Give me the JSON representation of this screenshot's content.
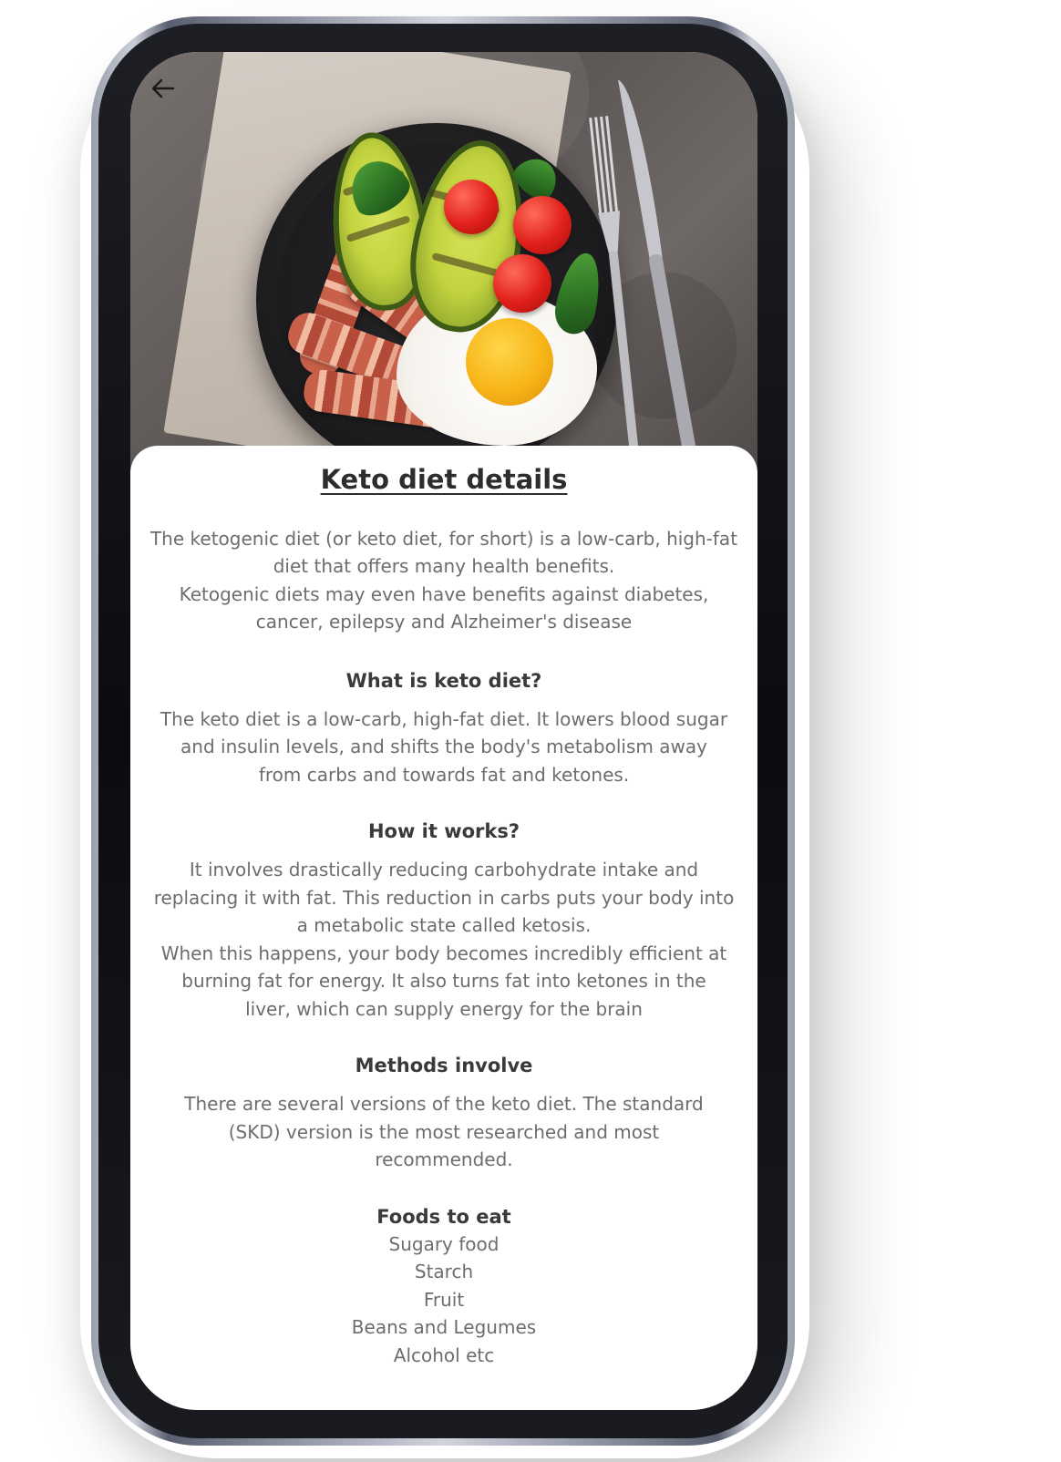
{
  "header": {
    "back_icon": "arrow-left-icon",
    "hero_image": "keto-breakfast-photo"
  },
  "article": {
    "title": "Keto diet details",
    "intro_line1": "The ketogenic diet (or keto diet, for short) is a low-carb, high-fat diet that offers many health benefits.",
    "intro_line2": "Ketogenic diets may even have benefits against diabetes, cancer, epilepsy and Alzheimer's disease",
    "sections": [
      {
        "heading": "What is keto diet?",
        "body": "The keto diet is a low-carb, high-fat diet. It lowers blood sugar and insulin levels, and shifts the body's metabolism away from carbs and towards fat and ketones."
      },
      {
        "heading": "How it works?",
        "body": "It involves drastically reducing carbohydrate intake and replacing it with fat. This reduction in carbs puts your body into a metabolic state called ketosis.",
        "body2": "When this happens, your body becomes incredibly efficient at burning fat for energy. It also turns fat into ketones in the liver, which can supply energy for the brain"
      },
      {
        "heading": "Methods involve",
        "body": "There are several versions of the keto diet. The standard (SKD) version is the most researched and most recommended."
      }
    ],
    "foods_heading": "Foods to eat",
    "foods": [
      "Sugary food",
      "Starch",
      "Fruit",
      "Beans and Legumes",
      "Alcohol etc"
    ]
  }
}
